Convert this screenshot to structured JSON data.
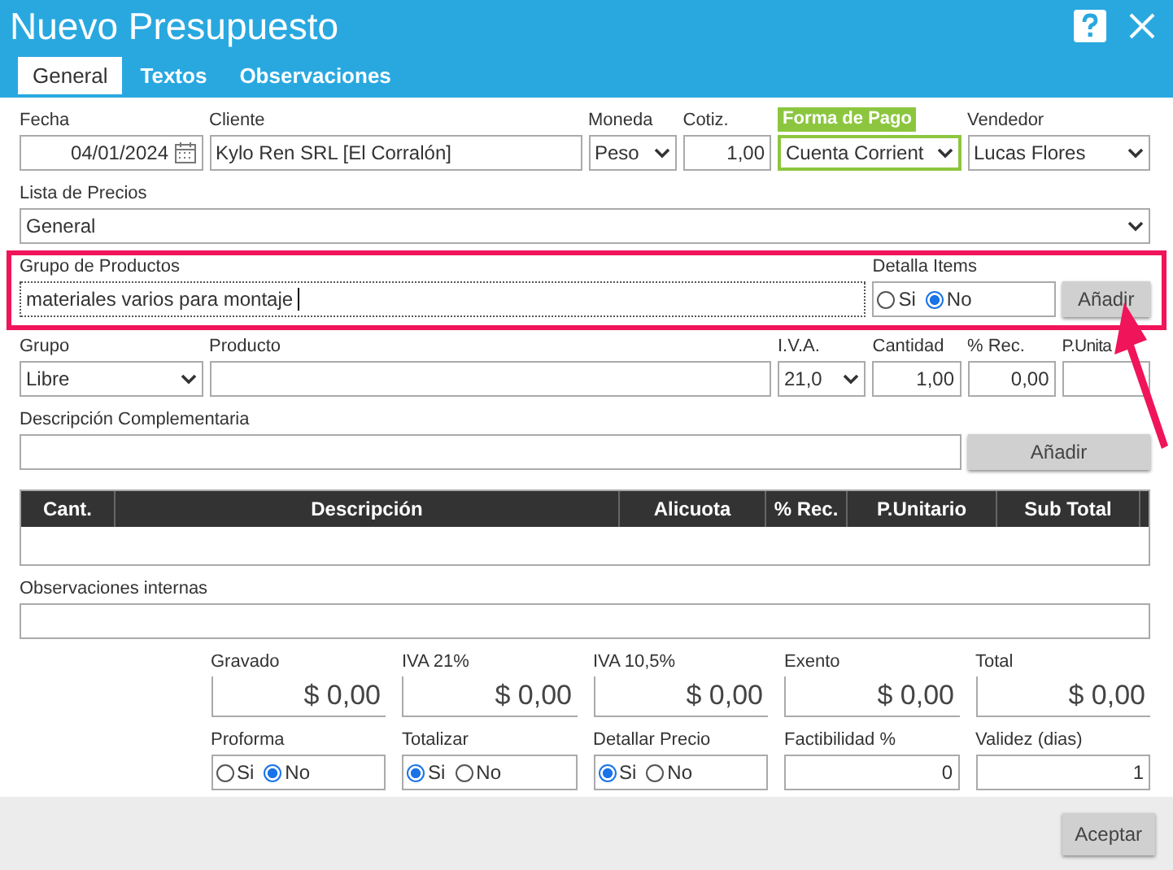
{
  "window": {
    "title": "Nuevo Presupuesto"
  },
  "tabs": [
    {
      "label": "General",
      "selected": true
    },
    {
      "label": "Textos",
      "selected": false
    },
    {
      "label": "Observaciones",
      "selected": false
    }
  ],
  "header_fields": [
    {
      "label": "Fecha",
      "kind": "date",
      "value": "04/01/2024",
      "highlighted": false
    },
    {
      "label": "Cliente",
      "kind": "text",
      "value": "Kylo Ren SRL [El Corralón]",
      "highlighted": false
    },
    {
      "label": "Moneda",
      "kind": "select",
      "value": "Peso",
      "highlighted": false
    },
    {
      "label": "Cotiz.",
      "kind": "number",
      "value": "1,00",
      "highlighted": false
    },
    {
      "label": "Forma de Pago",
      "kind": "select",
      "value": "Cuenta Corrient",
      "highlighted": true
    },
    {
      "label": "Vendedor",
      "kind": "select",
      "value": "Lucas Flores",
      "highlighted": false
    }
  ],
  "price_list": {
    "label": "Lista de Precios",
    "value": "General"
  },
  "product_group": {
    "label": "Grupo de Productos",
    "value": "materiales varios para montaje",
    "detail_label": "Detalla Items",
    "options": [
      {
        "label": "Si",
        "selected": false
      },
      {
        "label": "No",
        "selected": true
      }
    ],
    "button": "Añadir"
  },
  "item_fields": [
    {
      "label": "Grupo",
      "kind": "select",
      "value": "Libre"
    },
    {
      "label": "Producto",
      "kind": "text"
    },
    {
      "label": "I.V.A.",
      "kind": "select",
      "value": "21,0"
    },
    {
      "label": "Cantidad",
      "kind": "number",
      "value": "1,00"
    },
    {
      "label": "% Rec.",
      "kind": "number",
      "value": "0,00"
    },
    {
      "label": "P.Unita",
      "kind": "number"
    }
  ],
  "description": {
    "label": "Descripción Complementaria",
    "button": "Añadir"
  },
  "table": {
    "columns": [
      "Cant.",
      "Descripción",
      "Alicuota",
      "% Rec.",
      "P.Unitario",
      "Sub Total"
    ]
  },
  "notes": {
    "label": "Observaciones internas"
  },
  "totals": [
    {
      "label": "Gravado",
      "value": "$ 0,00"
    },
    {
      "label": "IVA 21%",
      "value": "$ 0,00"
    },
    {
      "label": "IVA 10,5%",
      "value": "$ 0,00"
    },
    {
      "label": "Exento",
      "value": "$ 0,00"
    },
    {
      "label": "Total",
      "value": "$ 0,00"
    }
  ],
  "options": [
    {
      "label": "Proforma",
      "kind": "radio",
      "options": [
        {
          "label": "Si",
          "selected": false
        },
        {
          "label": "No",
          "selected": true
        }
      ]
    },
    {
      "label": "Totalizar",
      "kind": "radio",
      "options": [
        {
          "label": "Si",
          "selected": true
        },
        {
          "label": "No",
          "selected": false
        }
      ]
    },
    {
      "label": "Detallar Precio",
      "kind": "radio",
      "options": [
        {
          "label": "Si",
          "selected": true
        },
        {
          "label": "No",
          "selected": false
        }
      ]
    },
    {
      "label": "Factibilidad %",
      "kind": "number",
      "value": "0"
    },
    {
      "label": "Validez (dias)",
      "kind": "number",
      "value": "1"
    }
  ],
  "footer": {
    "button": "Aceptar"
  }
}
